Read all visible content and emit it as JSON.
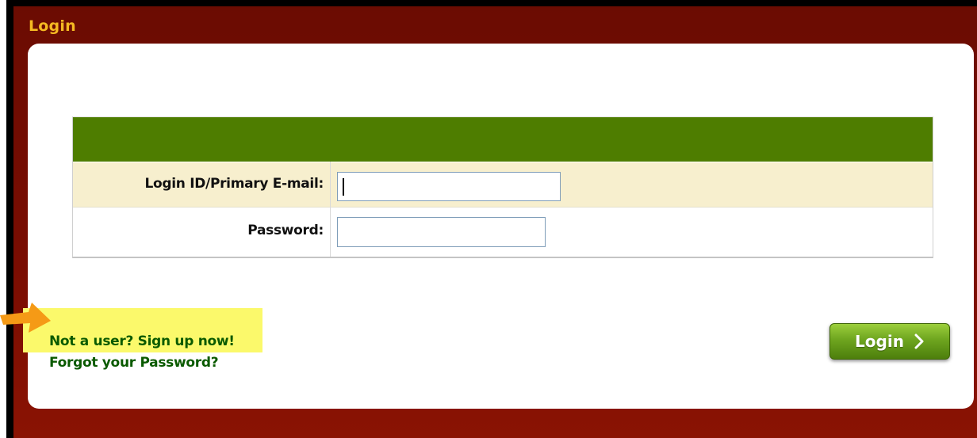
{
  "panel": {
    "title": "Login"
  },
  "form": {
    "email_label": "Login ID/Primary E-mail:",
    "email_value": "",
    "password_label": "Password:",
    "password_value": ""
  },
  "actions": {
    "login_button_label": "Login",
    "signup_link": "Not a user? Sign up now!",
    "forgot_link": "Forgot your Password?"
  },
  "icons": {
    "login_button_icon": "chevron-right-icon",
    "annotation_icon": "pointer-arrow-icon"
  },
  "colors": {
    "panel_background": "#7a0d02",
    "title_text": "#f5b922",
    "form_header": "#4e7d00",
    "email_row": "#f7efce",
    "button_green": "#6ea51f",
    "link_text": "#0a5a00",
    "highlight": "#fbf96b",
    "annotation_arrow": "#f59a16"
  }
}
